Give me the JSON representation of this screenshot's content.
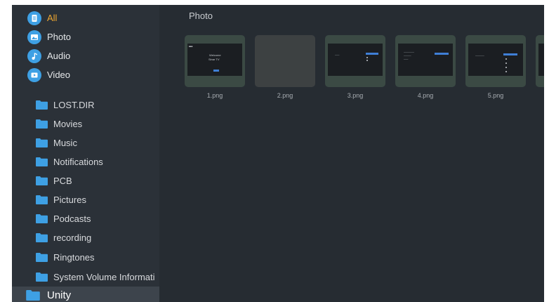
{
  "categories": [
    {
      "label": "All",
      "icon": "document-icon",
      "active": true
    },
    {
      "label": "Photo",
      "icon": "photo-icon",
      "active": false
    },
    {
      "label": "Audio",
      "icon": "music-note-icon",
      "active": false
    },
    {
      "label": "Video",
      "icon": "video-icon",
      "active": false
    }
  ],
  "folders": [
    {
      "label": "LOST.DIR"
    },
    {
      "label": "Movies"
    },
    {
      "label": "Music"
    },
    {
      "label": "Notifications"
    },
    {
      "label": "PCB"
    },
    {
      "label": "Pictures"
    },
    {
      "label": "Podcasts"
    },
    {
      "label": "recording"
    },
    {
      "label": "Ringtones"
    },
    {
      "label": "System Volume Informati"
    },
    {
      "label": "Unity",
      "selected": true
    }
  ],
  "content": {
    "title": "Photo",
    "files": [
      {
        "name": "1.png",
        "preview_text": [
          "Welcome",
          "Sinar TV"
        ]
      },
      {
        "name": "2.png"
      },
      {
        "name": "3.png"
      },
      {
        "name": "4.png"
      },
      {
        "name": "5.png"
      }
    ]
  },
  "colors": {
    "accent": "#f0a830",
    "icon_blue": "#3ea0e4",
    "background": "#262c32",
    "sidebar": "#2b3138",
    "selected_row": "#3d444c"
  }
}
